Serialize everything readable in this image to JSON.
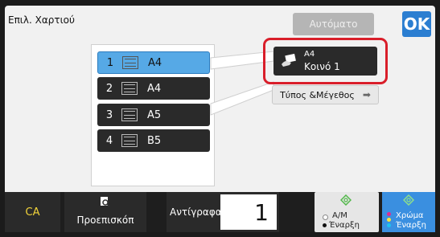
{
  "header": {
    "title": "Επιλ. Χαρτιού",
    "auto_label": "Αυτόματο",
    "ok_label": "OK"
  },
  "trays": [
    {
      "number": "1",
      "size": "A4",
      "selected": true
    },
    {
      "number": "2",
      "size": "A4",
      "selected": false
    },
    {
      "number": "3",
      "size": "A5",
      "selected": false
    },
    {
      "number": "4",
      "size": "B5",
      "selected": false
    }
  ],
  "selected_paper": {
    "size": "A4",
    "type": "Κοινό 1"
  },
  "type_size_button": {
    "label": "Τύπος &Μέγεθος",
    "icon": "arrow-right-icon"
  },
  "footer": {
    "ca_label": "CA",
    "preview_label": "Προεπισκόπ",
    "copies_label": "Αντίγραφα",
    "copies_value": "1",
    "bw_start": {
      "line1": "Α/Μ",
      "line2": "Έναρξη"
    },
    "color_start": {
      "line1": "Χρώμα",
      "line2": "Έναρξη"
    }
  },
  "colors": {
    "accent": "#2b7ed1",
    "selected_tray": "#56a9e6",
    "highlight_border": "#d91e2a",
    "ca_text": "#f2d43a",
    "color_button": "#3a8fe0"
  }
}
